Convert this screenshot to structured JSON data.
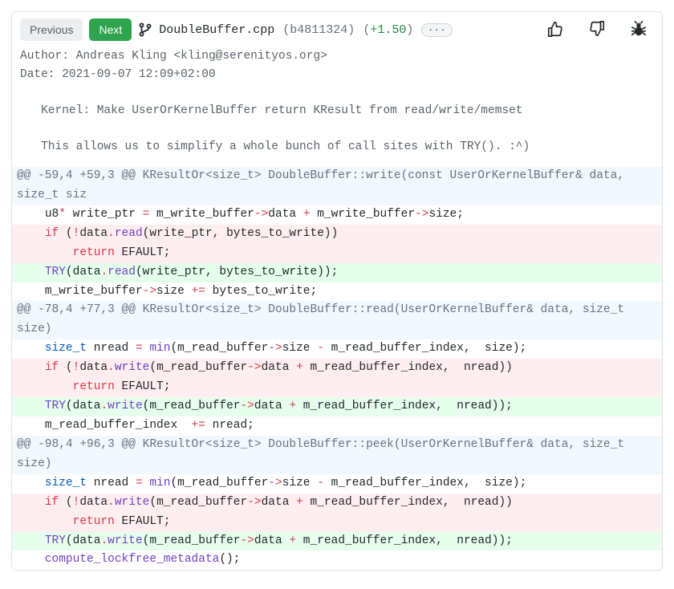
{
  "nav": {
    "prev": "Previous",
    "next": "Next"
  },
  "file": {
    "name": "DoubleBuffer.cpp",
    "hash": "(b4811324)",
    "score_open": "(",
    "score_val": "+1.50",
    "score_close": ")",
    "ellipsis": "···"
  },
  "commit": {
    "author_line": "Author: Andreas Kling <kling@serenityos.org>",
    "date_line": "Date: 2021-09-07 12:09+02:00",
    "blank1": "",
    "subject": "   Kernel: Make UserOrKernelBuffer return KResult from read/write/memset",
    "blank2": "",
    "body": "   This allows us to simplify a whole bunch of call sites with TRY(). :^)"
  },
  "hunks": {
    "h1": "@@ -59,4 +59,3 @@ KResultOr<size_t> DoubleBuffer::write(const UserOrKernelBuffer& data, size_t siz",
    "h2": "@@ -78,4 +77,3 @@ KResultOr<size_t> DoubleBuffer::read(UserOrKernelBuffer& data, size_t size)",
    "h3": "@@ -98,4 +96,3 @@ KResultOr<size_t> DoubleBuffer::peek(UserOrKernelBuffer& data, size_t size)"
  },
  "tok": {
    "sp4": "    ",
    "sp8": "        ",
    "u8": "u8",
    "star": "*",
    "write_ptr": " write_ptr ",
    "eq": "=",
    "m_write_buffer": " m_write_buffer",
    "arrow": "->",
    "datafld": "data ",
    "plus": "+",
    "sizefld": "size",
    "semi": ";",
    "if": "if",
    "lpar": " (",
    "bang": "!",
    "data": "data",
    "dot": ".",
    "read": "read",
    "open": "(",
    "write_ptr_arg": "write_ptr",
    "comma": ", ",
    "bytes_to_write": "bytes_to_write",
    "close2": "))",
    "close1": ")",
    "return": "return",
    "EFAULT": " EFAULT",
    "TRY": "TRY",
    "closeSemi": ");",
    "sizeline_prefix": "    m_write_buffer",
    "pluseq": " +=",
    "btw2": " bytes_to_write",
    "size_t": "size_t",
    "nread": " nread ",
    "min": "min",
    "m_read_buffer": "m_read_buffer",
    "minus": " -",
    "m_read_buffer_index": " m_read_buffer_index",
    "sizearg": " size",
    "write": "write",
    "nread_arg": " nread",
    "idxline_prefix": "    m_read_buffer_index ",
    "nread_plain": " nread",
    "compute": "compute_lockfree_metadata",
    "unit": "()"
  }
}
